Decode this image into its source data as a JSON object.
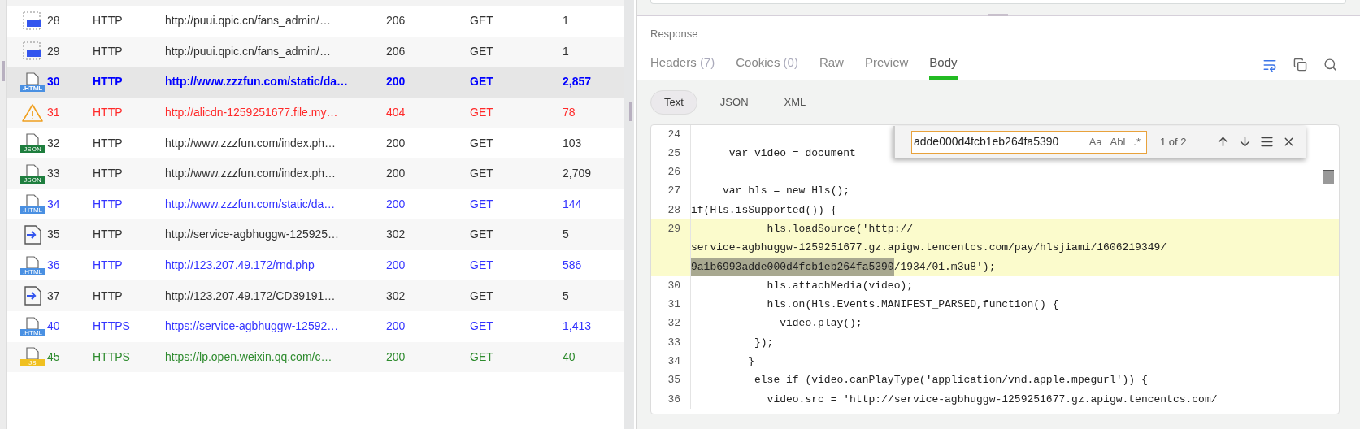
{
  "sessions": {
    "rows": [
      {
        "kind": "image",
        "number": "28",
        "protocol": "HTTP",
        "url": "http://puui.qpic.cn/fans_admin/…",
        "status": "206",
        "method": "GET",
        "size": "1",
        "color": "#333333",
        "selected": false
      },
      {
        "kind": "image",
        "number": "29",
        "protocol": "HTTP",
        "url": "http://puui.qpic.cn/fans_admin/…",
        "status": "206",
        "method": "GET",
        "size": "1",
        "color": "#333333",
        "selected": false
      },
      {
        "kind": "html",
        "badge": ".HTML",
        "number": "30",
        "protocol": "HTTP",
        "url": "http://www.zzzfun.com/static/da…",
        "status": "200",
        "method": "GET",
        "size": "2,857",
        "color": "#0000ff",
        "selected": true
      },
      {
        "kind": "warning",
        "number": "31",
        "protocol": "HTTP",
        "url": "http://alicdn-1259251677.file.my…",
        "status": "404",
        "method": "GET",
        "size": "78",
        "color": "#ff2a2a",
        "selected": false
      },
      {
        "kind": "json",
        "badge": "JSON",
        "number": "32",
        "protocol": "HTTP",
        "url": "http://www.zzzfun.com/index.ph…",
        "status": "200",
        "method": "GET",
        "size": "103",
        "color": "#333333",
        "selected": false
      },
      {
        "kind": "json",
        "badge": "JSON",
        "number": "33",
        "protocol": "HTTP",
        "url": "http://www.zzzfun.com/index.ph…",
        "status": "200",
        "method": "GET",
        "size": "2,709",
        "color": "#333333",
        "selected": false
      },
      {
        "kind": "html",
        "badge": ".HTML",
        "number": "34",
        "protocol": "HTTP",
        "url": "http://www.zzzfun.com/static/da…",
        "status": "200",
        "method": "GET",
        "size": "144",
        "color": "#3333ff",
        "selected": false
      },
      {
        "kind": "redirect",
        "number": "35",
        "protocol": "HTTP",
        "url": "http://service-agbhuggw-125925…",
        "status": "302",
        "method": "GET",
        "size": "5",
        "color": "#333333",
        "selected": false
      },
      {
        "kind": "html",
        "badge": ".HTML",
        "number": "36",
        "protocol": "HTTP",
        "url": "http://123.207.49.172/rnd.php",
        "status": "200",
        "method": "GET",
        "size": "586",
        "color": "#3333ff",
        "selected": false
      },
      {
        "kind": "redirect",
        "number": "37",
        "protocol": "HTTP",
        "url": "http://123.207.49.172/CD39191…",
        "status": "302",
        "method": "GET",
        "size": "5",
        "color": "#333333",
        "selected": false
      },
      {
        "kind": "html",
        "badge": ".HTML",
        "number": "40",
        "protocol": "HTTPS",
        "url": "https://service-agbhuggw-12592…",
        "status": "200",
        "method": "GET",
        "size": "1,413",
        "color": "#3333ff",
        "selected": false
      },
      {
        "kind": "js",
        "badge": "JS",
        "number": "45",
        "protocol": "HTTPS",
        "url": "https://lp.open.weixin.qq.com/c…",
        "status": "200",
        "method": "GET",
        "size": "40",
        "color": "#2e8b2e",
        "selected": false
      }
    ]
  },
  "response": {
    "title": "Response",
    "tabs": [
      {
        "label": "Headers",
        "count": "(7)",
        "selected": false
      },
      {
        "label": "Cookies",
        "count": "(0)",
        "selected": false
      },
      {
        "label": "Raw",
        "selected": false
      },
      {
        "label": "Preview",
        "selected": false
      },
      {
        "label": "Body",
        "selected": true
      }
    ],
    "formats": [
      {
        "label": "Text",
        "selected": true
      },
      {
        "label": "JSON",
        "selected": false
      },
      {
        "label": "XML",
        "selected": false
      }
    ],
    "find": {
      "value": "adde000d4fcb1eb264fa5390",
      "toggles": [
        "Aa",
        "Abl",
        ".*"
      ],
      "count": "1 of 2"
    },
    "code": [
      {
        "number": "24",
        "highlighted": false,
        "rows": [
          [
            {
              "text": ""
            }
          ]
        ]
      },
      {
        "number": "25",
        "highlighted": false,
        "rows": [
          [
            {
              "text": "      var video = document"
            }
          ]
        ]
      },
      {
        "number": "26",
        "highlighted": false,
        "rows": [
          [
            {
              "text": ""
            }
          ]
        ]
      },
      {
        "number": "27",
        "highlighted": false,
        "rows": [
          [
            {
              "text": "     var hls = new Hls();"
            }
          ]
        ]
      },
      {
        "number": "28",
        "highlighted": false,
        "rows": [
          [
            {
              "text": "if(Hls.isSupported()) {"
            }
          ]
        ]
      },
      {
        "number": "29",
        "highlighted": true,
        "rows": [
          [
            {
              "text": "            hls.loadSource('http://"
            }
          ],
          [
            {
              "text": "service-agbhuggw-1259251677.gz.apigw.tencentcs.com/pay/hlsjiami/1606219349/"
            }
          ],
          [
            {
              "text": "9a1b6993adde000d4fcb1eb264fa5390",
              "match": true
            },
            {
              "text": "/1934/01.m3u8');"
            }
          ]
        ]
      },
      {
        "number": "30",
        "highlighted": false,
        "rows": [
          [
            {
              "text": "            hls.attachMedia(video);"
            }
          ]
        ]
      },
      {
        "number": "31",
        "highlighted": false,
        "rows": [
          [
            {
              "text": "            hls.on(Hls.Events.MANIFEST_PARSED,function() {"
            }
          ]
        ]
      },
      {
        "number": "32",
        "highlighted": false,
        "rows": [
          [
            {
              "text": "              video.play();"
            }
          ]
        ]
      },
      {
        "number": "33",
        "highlighted": false,
        "rows": [
          [
            {
              "text": "          });"
            }
          ]
        ]
      },
      {
        "number": "34",
        "highlighted": false,
        "rows": [
          [
            {
              "text": "         }"
            }
          ]
        ]
      },
      {
        "number": "35",
        "highlighted": false,
        "rows": [
          [
            {
              "text": "          else if (video.canPlayType('application/vnd.apple.mpegurl')) {"
            }
          ]
        ]
      },
      {
        "number": "36",
        "highlighted": false,
        "rows": [
          [
            {
              "text": "            video.src = 'http://service-agbhuggw-1259251677.gz.apigw.tencentcs.com/"
            }
          ]
        ]
      }
    ]
  }
}
